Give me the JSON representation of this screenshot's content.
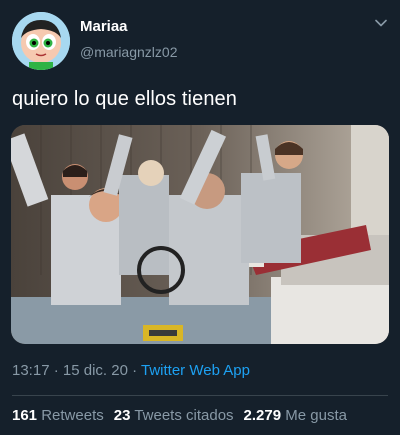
{
  "user": {
    "name": "Mariaa",
    "handle": "@mariagnzlz02"
  },
  "tweet": {
    "text": "quiero lo que ellos tienen"
  },
  "meta": {
    "time": "13:17",
    "sep1": " · ",
    "date": "15 dic. 20",
    "sep2": " · ",
    "source": "Twitter Web App"
  },
  "stats": {
    "retweets_count": "161",
    "retweets_label": "Retweets",
    "quotes_count": "23",
    "quotes_label": "Tweets citados",
    "likes_count": "2.279",
    "likes_label": "Me gusta"
  },
  "colors": {
    "background": "#15202b",
    "secondary_text": "#8899a6",
    "link": "#1da1f2"
  },
  "icons": {
    "menu": "chevron-down-icon"
  }
}
